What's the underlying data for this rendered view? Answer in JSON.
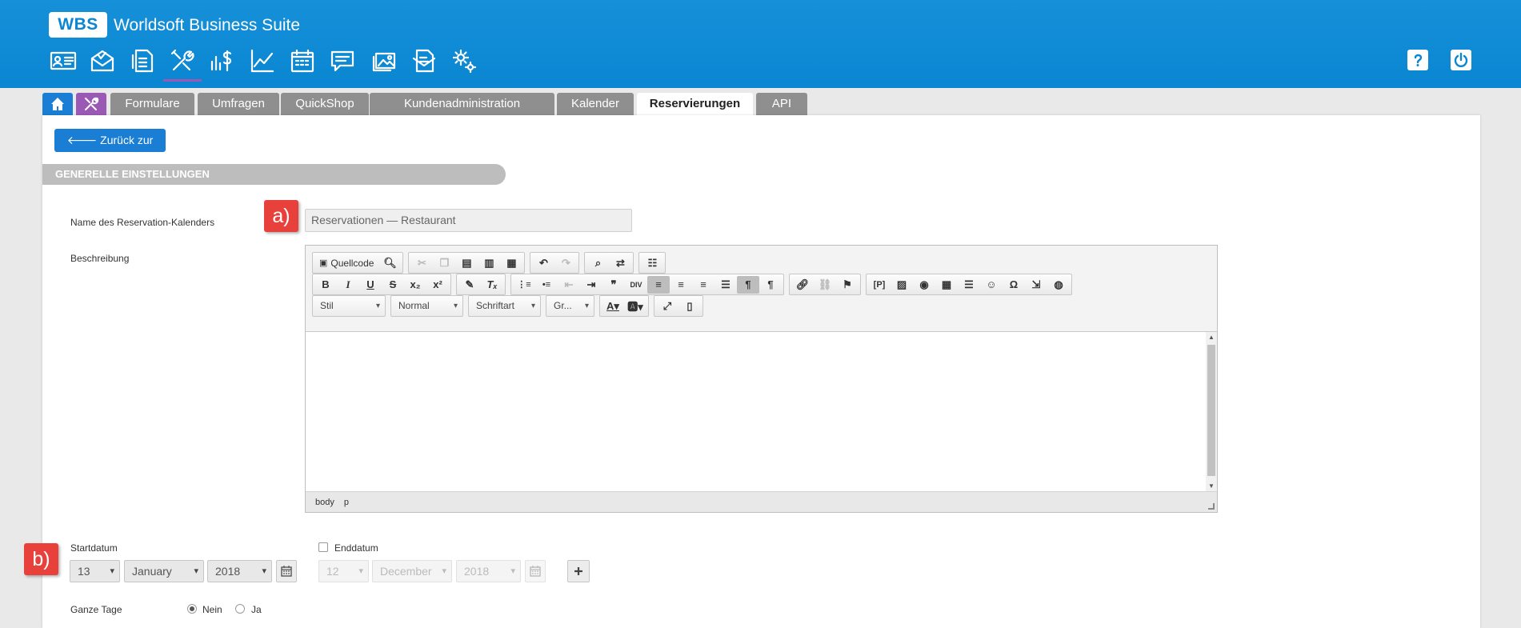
{
  "app": {
    "logo": "WBS",
    "title": "Worldsoft Business Suite"
  },
  "nav_icons": [
    "contact-card-icon",
    "mail-icon",
    "document-money-icon",
    "tools-icon",
    "finance-icon",
    "statistics-icon",
    "calendar-icon",
    "chat-icon",
    "gallery-icon",
    "newsletter-icon",
    "settings-icon"
  ],
  "header_icons": [
    "help-icon",
    "power-icon"
  ],
  "tabs": [
    {
      "label": "Formulare"
    },
    {
      "label": "Umfragen"
    },
    {
      "label": "QuickShop"
    },
    {
      "label": "Kundenadministration"
    },
    {
      "label": "Kalender"
    },
    {
      "label": "Reservierungen",
      "active": true
    },
    {
      "label": "API"
    }
  ],
  "back_button": "🡐 Zurück zur Liste",
  "section_title": "GENERELLE EINSTELLUNGEN",
  "form": {
    "name_label": "Name des Reservation-Kalenders",
    "name_value": "Reservationen — Restaurant",
    "description_label": "Beschreibung",
    "badge_a": "a)",
    "badge_b": "b)"
  },
  "editor": {
    "source_label": "Quellcode",
    "style_dropdown": "Stil",
    "format_dropdown": "Normal",
    "font_dropdown": "Schriftart",
    "size_dropdown": "Gr...",
    "status_path": [
      "body",
      "p"
    ]
  },
  "start": {
    "label": "Startdatum",
    "day": "13",
    "month": "January",
    "year": "2018"
  },
  "end": {
    "label": "Enddatum",
    "day": "12",
    "month": "December",
    "year": "2018"
  },
  "allday": {
    "label": "Ganze Tage",
    "options": [
      "Nein",
      "Ja"
    ],
    "selected": "Nein"
  },
  "colors": {
    "header": "#0a86d2",
    "accent": "#1a7fd4",
    "tools_tab": "#9b59b6",
    "badge": "#e8413c"
  }
}
